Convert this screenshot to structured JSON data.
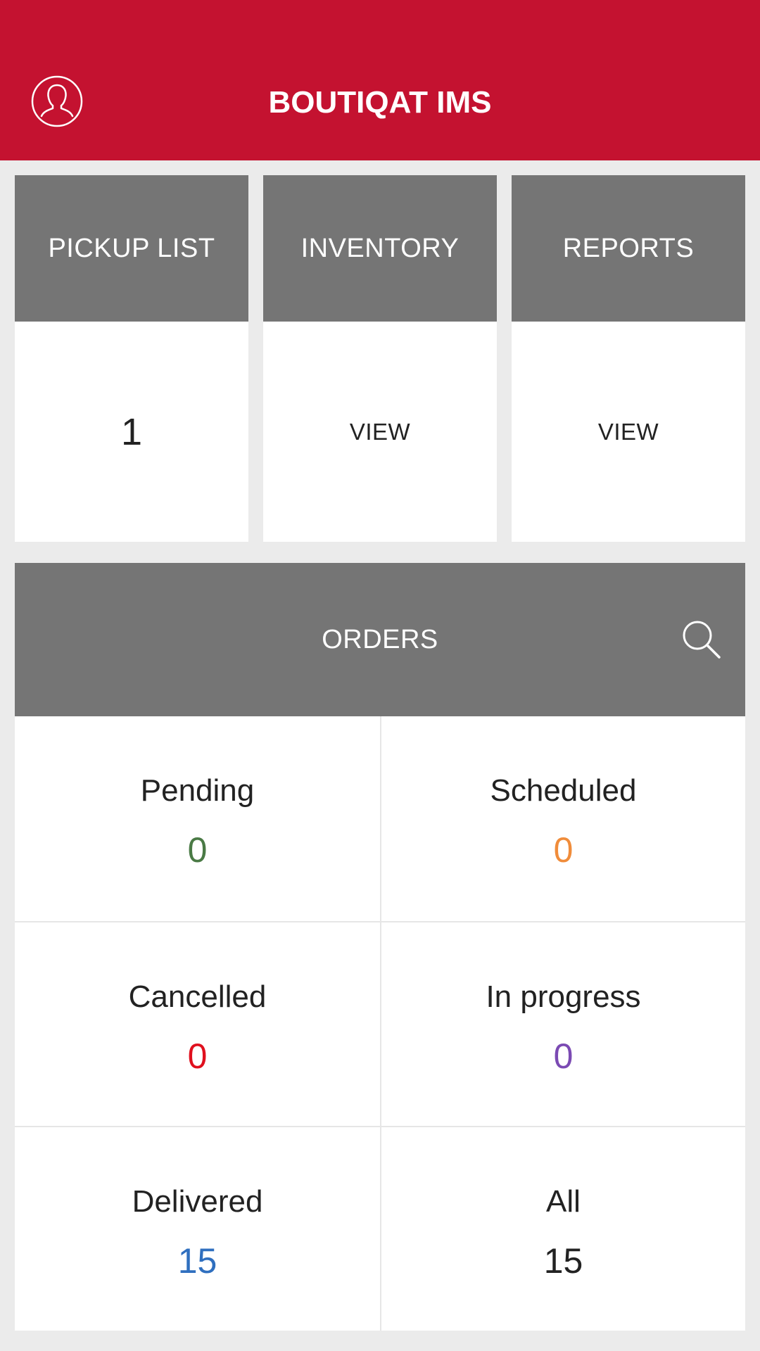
{
  "header": {
    "title": "BOUTIQAT IMS",
    "profile_icon": "user-profile-icon",
    "background_color": "#c41230"
  },
  "tiles": [
    {
      "label": "PICKUP LIST",
      "value": "1"
    },
    {
      "label": "INVENTORY",
      "value": "VIEW"
    },
    {
      "label": "REPORTS",
      "value": "VIEW"
    }
  ],
  "orders": {
    "title": "ORDERS",
    "search_icon": "search-icon",
    "statuses": [
      {
        "label": "Pending",
        "count": "0",
        "color": "#4a7a45"
      },
      {
        "label": "Scheduled",
        "count": "0",
        "color": "#f08c3a"
      },
      {
        "label": "Cancelled",
        "count": "0",
        "color": "#e0101e"
      },
      {
        "label": "In progress",
        "count": "0",
        "color": "#7b4ab3"
      },
      {
        "label": "Delivered",
        "count": "15",
        "color": "#2f6fbf"
      },
      {
        "label": "All",
        "count": "15",
        "color": "#222222"
      }
    ]
  }
}
